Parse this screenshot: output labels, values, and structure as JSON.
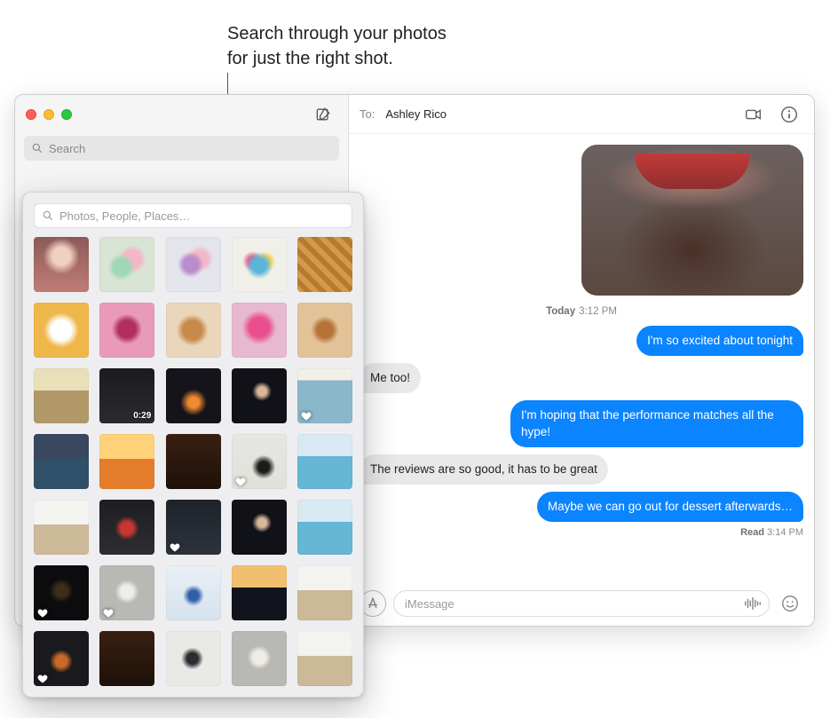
{
  "annotation": {
    "line1": "Search through your photos",
    "line2": "for just the right shot."
  },
  "sidebar": {
    "search_placeholder": "Search"
  },
  "conversation": {
    "to_label": "To:",
    "recipient": "Ashley Rico",
    "timestamp_day": "Today",
    "timestamp_time": "3:12 PM",
    "msg_out_1": "I'm so excited about tonight",
    "msg_in_1": "Me too!",
    "msg_out_2": "I'm hoping that the performance matches all the hype!",
    "msg_in_2": "The reviews are so good, it has to be great",
    "msg_out_3": "Maybe we can go out for dessert afterwards…",
    "read_label": "Read",
    "read_time": "3:14 PM",
    "input_placeholder": "iMessage"
  },
  "photos_popover": {
    "search_placeholder": "Photos, People, Places…",
    "items": [
      {
        "theme": "c-portrait"
      },
      {
        "theme": "c-macaron1"
      },
      {
        "theme": "c-macaron2"
      },
      {
        "theme": "c-candy"
      },
      {
        "theme": "c-waffles"
      },
      {
        "theme": "c-plate1"
      },
      {
        "theme": "c-berry"
      },
      {
        "theme": "c-pastry"
      },
      {
        "theme": "c-pinkcake"
      },
      {
        "theme": "c-donut"
      },
      {
        "theme": "c-reeds"
      },
      {
        "theme": "c-dark1",
        "duration": "0:29"
      },
      {
        "theme": "c-fire"
      },
      {
        "theme": "c-person-dark"
      },
      {
        "theme": "c-ocean",
        "favorite": true
      },
      {
        "theme": "c-sunset1"
      },
      {
        "theme": "c-orange"
      },
      {
        "theme": "c-warmdark"
      },
      {
        "theme": "c-siluet",
        "favorite": true
      },
      {
        "theme": "c-pool"
      },
      {
        "theme": "c-dunesA"
      },
      {
        "theme": "c-redshirt"
      },
      {
        "theme": "c-darkfav",
        "favorite": true
      },
      {
        "theme": "c-person-dark"
      },
      {
        "theme": "c-pool"
      },
      {
        "theme": "c-blackglow",
        "favorite": true
      },
      {
        "theme": "c-greyport",
        "favorite": true
      },
      {
        "theme": "c-blueguy"
      },
      {
        "theme": "c-horizon1"
      },
      {
        "theme": "c-dunesA"
      },
      {
        "theme": "c-orangeperson",
        "favorite": true
      },
      {
        "theme": "c-warmdark"
      },
      {
        "theme": "c-grayfig"
      },
      {
        "theme": "c-greyport"
      },
      {
        "theme": "c-dunesA"
      }
    ]
  }
}
